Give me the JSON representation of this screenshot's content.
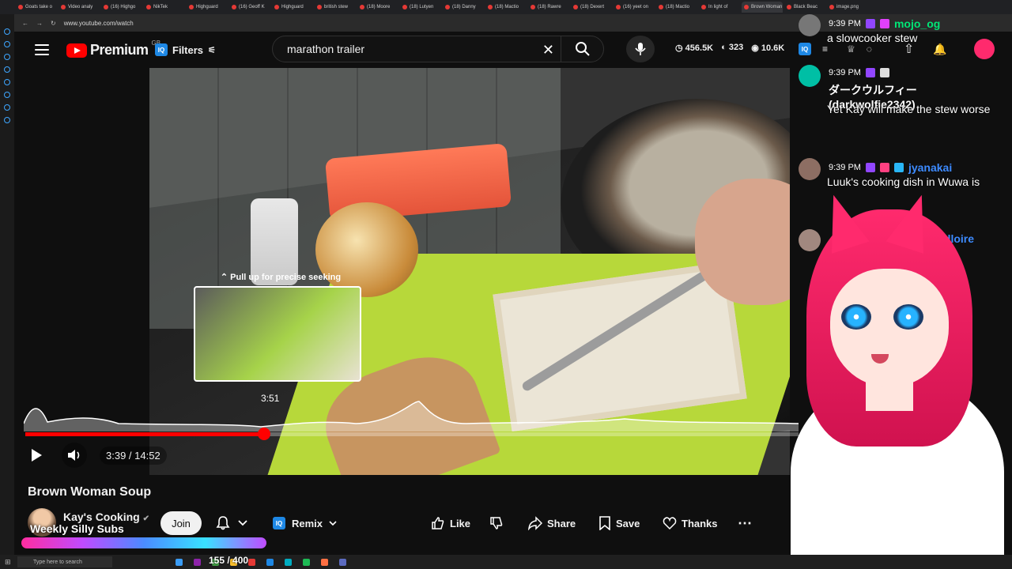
{
  "browser": {
    "tabs": [
      "Goats take o",
      "Video analy",
      "(16) Highgo",
      "NikTek",
      "Highguard",
      "(16) Geoff K",
      "Highguard",
      "british stew",
      "(18) Moore",
      "(18) Lutyen",
      "(18) Danny",
      "(18) Mactio",
      "(18) Rawre",
      "(18) Dexert",
      "(16) yeet on",
      "(18) Mactio",
      "In light of",
      "Brown Woman",
      "Black Beac",
      "image.png"
    ],
    "active_tab": "Brown Woman",
    "url": "www.youtube.com/watch"
  },
  "youtube": {
    "logo_text": "Premium",
    "region": "GB",
    "filters_label": "Filters",
    "search_value": "marathon trailer",
    "stats": [
      "456.5K",
      "323",
      "10.6K"
    ]
  },
  "player": {
    "seek_hint": "⌃ Pull up for precise seeking",
    "preview_time": "3:51",
    "current_time": "3:39",
    "duration": "14:52",
    "time_text": "3:39 / 14:52",
    "progress_fraction": 0.309
  },
  "video_info": {
    "title": "Brown Woman Soup",
    "channel_name": "Kay's Cooking",
    "overlay_text": "Weekly Silly Subs",
    "join_label": "Join",
    "remix_label": "Remix",
    "like_label": "Like",
    "share_label": "Share",
    "save_label": "Save",
    "thanks_label": "Thanks"
  },
  "chat": {
    "messages": [
      {
        "time": "9:39 PM",
        "user": "mojo_og",
        "text": "a slowcooker stew",
        "user_color": "#00e676"
      },
      {
        "time": "9:39 PM",
        "user": "ダークウルフィー (darkwolfie2342)",
        "text": "Yet Kay will make the stew worse",
        "user_color": "#ffffff"
      },
      {
        "time": "9:39 PM",
        "user": "jyanakai",
        "text": "Luuk's cooking dish in Wuwa is",
        "user_color": "#3d8bff"
      },
      {
        "time": "",
        "user": "ldloire",
        "text": "",
        "user_color": "#3d8bff"
      }
    ]
  },
  "taskbar": {
    "search_placeholder": "Type here to search",
    "counter": "155 / 400"
  },
  "colors": {
    "accent": "#ff0000",
    "background": "#0f0f0f",
    "vtuber_hair": "#ff2a6d"
  }
}
